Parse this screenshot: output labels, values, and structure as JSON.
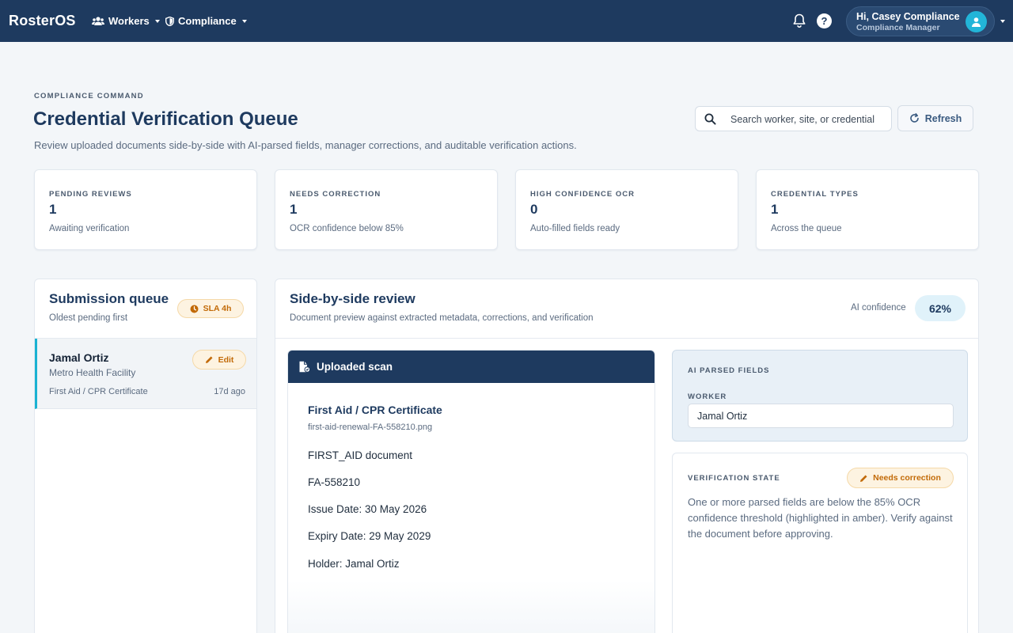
{
  "app": {
    "brand": "RosterOS",
    "nav": [
      {
        "label": "Workers",
        "icon": "users-icon"
      },
      {
        "label": "Compliance",
        "icon": "shield-icon"
      }
    ],
    "user": {
      "greeting": "Hi, Casey Compliance",
      "role": "Compliance Manager",
      "icon": "user-icon"
    },
    "icons": {
      "notifications": "bell-icon",
      "help": "help-icon",
      "help_glyph": "?"
    }
  },
  "header": {
    "eyebrow": "COMPLIANCE COMMAND",
    "title": "Credential Verification Queue",
    "subtitle": "Review uploaded documents side-by-side with AI-parsed fields, manager corrections, and auditable verification actions.",
    "search_placeholder": "Search worker, site, or credential",
    "refresh_label": "Refresh"
  },
  "stats": [
    {
      "label": "PENDING REVIEWS",
      "value": "1",
      "note": "Awaiting verification"
    },
    {
      "label": "NEEDS CORRECTION",
      "value": "1",
      "note": "OCR confidence below 85%"
    },
    {
      "label": "HIGH CONFIDENCE OCR",
      "value": "0",
      "note": "Auto-filled fields ready"
    },
    {
      "label": "CREDENTIAL TYPES",
      "value": "1",
      "note": "Across the queue"
    }
  ],
  "queue": {
    "title": "Submission queue",
    "subtitle": "Oldest pending first",
    "sla_label": "SLA 4h",
    "items": [
      {
        "name": "Jamal Ortiz",
        "site": "Metro Health Facility",
        "credential": "First Aid / CPR Certificate",
        "age": "17d ago",
        "action": "Edit"
      }
    ]
  },
  "review": {
    "title": "Side-by-side review",
    "subtitle": "Document preview against extracted metadata, corrections, and verification",
    "ai_confidence_label": "AI confidence",
    "ai_confidence_value": "62%",
    "scan": {
      "header": "Uploaded scan",
      "doc_title": "First Aid / CPR Certificate",
      "file_name": "first-aid-renewal-FA-558210.png",
      "lines": [
        "FIRST_AID document",
        "FA-558210",
        "Issue Date: 30 May 2026",
        "Expiry Date: 29 May 2029",
        "Holder: Jamal Ortiz"
      ]
    },
    "parsed": {
      "label": "AI PARSED FIELDS",
      "worker_label": "WORKER",
      "worker_value": "Jamal Ortiz"
    },
    "verification": {
      "label": "VERIFICATION STATE",
      "badge": "Needs correction",
      "text": "One or more parsed fields are below the 85% OCR confidence threshold (highlighted in amber). Verify against the document before approving."
    }
  },
  "colors": {
    "navy": "#1e3a5f",
    "accent": "#19b2d2",
    "amber": "#c26a07",
    "amber_bg": "#fdf3e1"
  }
}
